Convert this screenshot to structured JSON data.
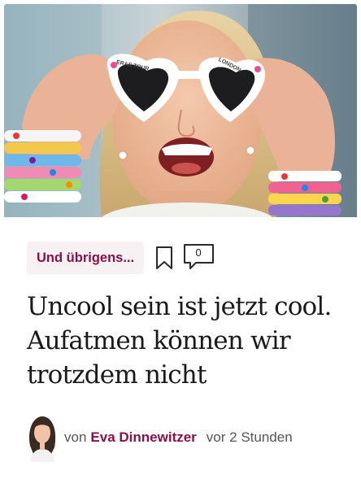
{
  "article": {
    "category": "Und übrigens...",
    "comment_count": "0",
    "headline": "Uncool sein ist jetzt cool. Aufatmen können wir trotzdem nicht",
    "byline_prefix": "von",
    "author": "Eva Dinnewitzer",
    "timestamp": "vor 2 Stunden",
    "image_text": {
      "glasses_left": "ERAS TOUR",
      "glasses_right": "LONDON"
    }
  },
  "colors": {
    "accent": "#8a1147",
    "badge_bg": "#f7f1f3",
    "headline": "#1a1a1a",
    "meta_text": "#555555"
  },
  "icons": {
    "bookmark": "bookmark-icon",
    "comments": "comment-bubble-icon",
    "avatar": "author-avatar"
  }
}
